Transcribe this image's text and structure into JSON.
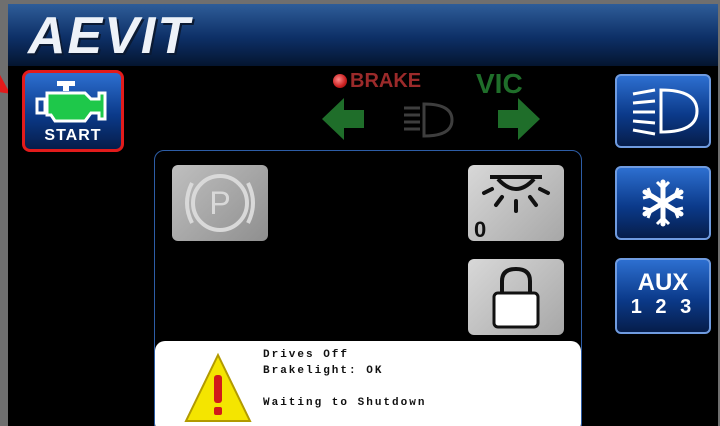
{
  "header": {
    "logo_text": "AEVIT"
  },
  "start_button": {
    "label": "START",
    "border_color": "#e21b1b",
    "icon": "engine-icon"
  },
  "indicators": {
    "brake_label": "BRAKE",
    "vic_label": "VIC",
    "left_turn_icon": "arrow-left-icon",
    "right_turn_icon": "arrow-right-icon",
    "headlight_icon": "low-beam-icon"
  },
  "sidebar": {
    "high_beam_icon": "high-beam-icon",
    "fan_icon": "snowflake-icon",
    "aux": {
      "title": "AUX",
      "numbers": "1 2 3"
    }
  },
  "panel": {
    "park_icon": "parking-brake-icon",
    "dome_light": {
      "icon": "dome-light-icon",
      "level": "0"
    },
    "lock_icon": "lock-icon",
    "message": {
      "icon": "warning-icon",
      "line1": "Drives Off",
      "line2": "Brakelight: OK",
      "line3": "Waiting to Shutdown"
    }
  },
  "colors": {
    "accent_blue": "#0b3a8a",
    "turn_green": "#1f6e2a",
    "brake_red": "#9b2a2a",
    "engine_green": "#1ec84a"
  }
}
